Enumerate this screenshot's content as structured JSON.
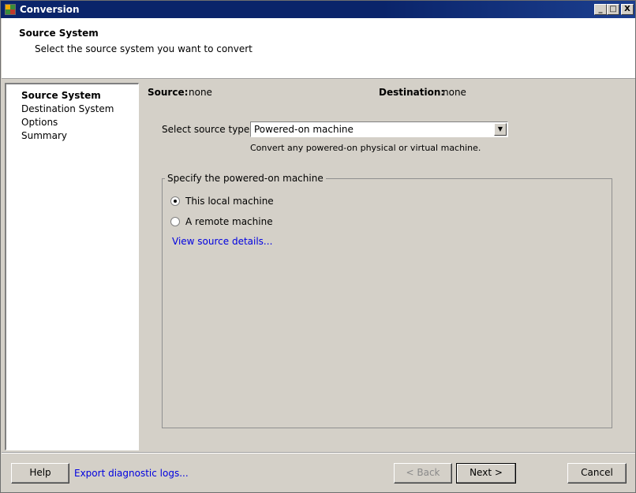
{
  "window": {
    "title": "Conversion",
    "minimize": "_",
    "maximize": "□",
    "close": "X"
  },
  "header": {
    "title": "Source System",
    "subtitle": "Select the source system you want to convert"
  },
  "steps": [
    "Source System",
    "Destination System",
    "Options",
    "Summary"
  ],
  "summary": {
    "source_label": "Source:",
    "source_value": "none",
    "destination_label": "Destination:",
    "destination_value": "none"
  },
  "source_type": {
    "label": "Select source type:",
    "value": "Powered-on machine",
    "hint": "Convert any powered-on physical or virtual machine."
  },
  "group": {
    "legend": "Specify the powered-on machine",
    "options": [
      {
        "label": "This local machine",
        "checked": true
      },
      {
        "label": "A remote machine",
        "checked": false
      }
    ],
    "details_link": "View source details..."
  },
  "footer": {
    "help": "Help",
    "export_logs": "Export diagnostic logs...",
    "back": "< Back",
    "next": "Next >",
    "cancel": "Cancel"
  },
  "colors": {
    "titlebar": "#0a246a",
    "link": "#0000e0",
    "background": "#d4d0c8"
  }
}
